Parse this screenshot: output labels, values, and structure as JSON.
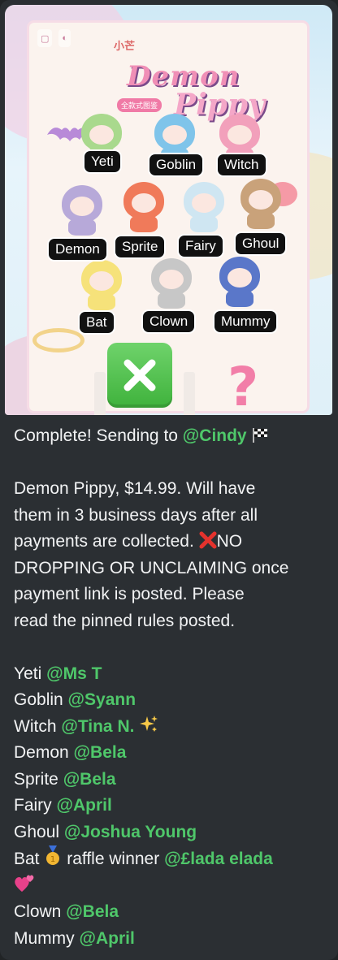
{
  "image": {
    "topbar_brand": "小芒",
    "title_line1": "Demon",
    "title_line2": "Pippy",
    "subtitle_tag": "全款式图鉴",
    "labels": [
      "Yeti",
      "Goblin",
      "Witch",
      "Demon",
      "Sprite",
      "Fairy",
      "Ghoul",
      "Bat",
      "Clown",
      "Mummy"
    ],
    "figure_colors": [
      "#a9d98d",
      "#7fc4ea",
      "#f2a0bb",
      "#b7a9d9",
      "#f07a5a",
      "#cfe6f2",
      "#c9a27a",
      "#f6e27a",
      "#c7c7c7",
      "#5a77c9"
    ],
    "check_icon": "cross-mark-icon",
    "unknown_mark": "?"
  },
  "message": {
    "intro_text": "Complete! Sending to ",
    "intro_mention": "@Cindy",
    "intro_icon": "chequered-flag-icon",
    "body_lines": [
      "Demon Pippy, $14.99. Will have",
      "them in 3 business days after all",
      "payments are collected.",
      "DROPPING OR UNCLAIMING once",
      "payment link is posted. Please",
      "read the pinned rules posted."
    ],
    "no_prefix": "NO",
    "no_icon": "red-x-icon",
    "assignments": [
      {
        "item": "Yeti",
        "mention": "@Ms T"
      },
      {
        "item": "Goblin",
        "mention": "@Syann"
      },
      {
        "item": "Witch",
        "mention": "@Tina N."
      },
      {
        "item": "Demon",
        "mention": "@Bela"
      },
      {
        "item": "Sprite",
        "mention": "@Bela"
      },
      {
        "item": "Fairy",
        "mention": "@April"
      },
      {
        "item": "Ghoul",
        "mention": "@Joshua Young"
      },
      {
        "item": "Bat",
        "middle": "raffle winner",
        "mention": "@£lada elada"
      },
      {
        "item": "Clown",
        "mention": "@Bela"
      },
      {
        "item": "Mummy",
        "mention": "@April"
      }
    ],
    "colors": {
      "mention": "#4fc76a",
      "text": "#f2f3f4",
      "bubble": "#2b2f33"
    }
  }
}
